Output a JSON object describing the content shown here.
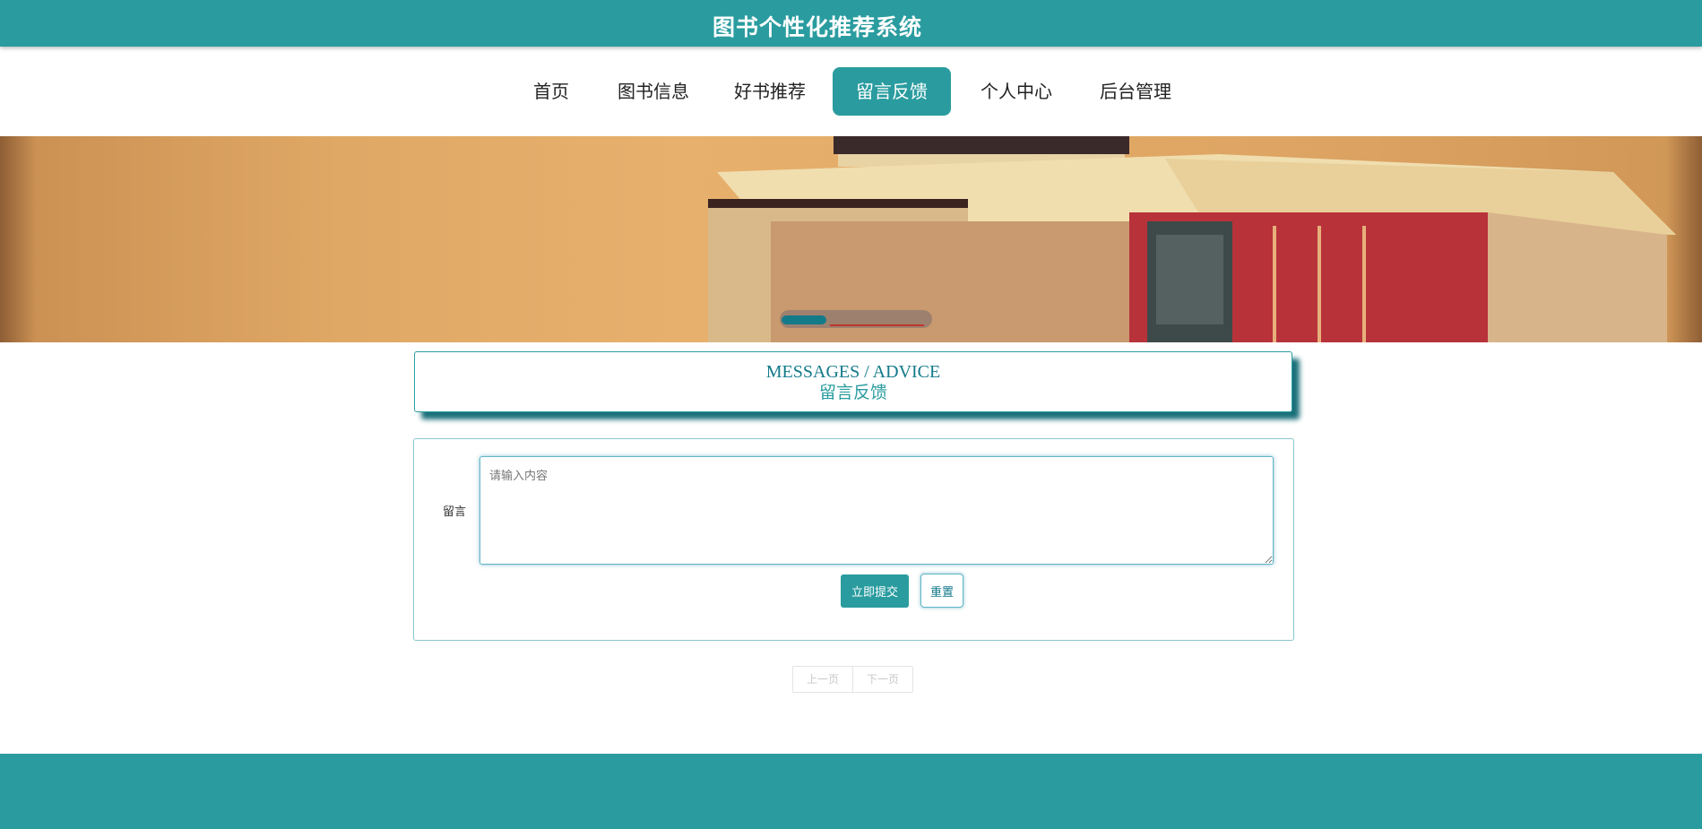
{
  "header": {
    "title": "图书个性化推荐系统"
  },
  "nav": {
    "items": [
      {
        "label": "首页"
      },
      {
        "label": "图书信息"
      },
      {
        "label": "好书推荐"
      },
      {
        "label": "留言反馈",
        "active": true
      },
      {
        "label": "个人中心"
      },
      {
        "label": "后台管理"
      }
    ]
  },
  "section": {
    "title_en": "MESSAGES / ADVICE",
    "title_cn": "留言反馈"
  },
  "form": {
    "label": "留言",
    "placeholder": "请输入内容",
    "submit_label": "立即提交",
    "reset_label": "重置"
  },
  "pager": {
    "prev_label": "上一页",
    "next_label": "下一页"
  },
  "colors": {
    "primary": "#2a9c9f",
    "accent_dark": "#137a8a"
  }
}
